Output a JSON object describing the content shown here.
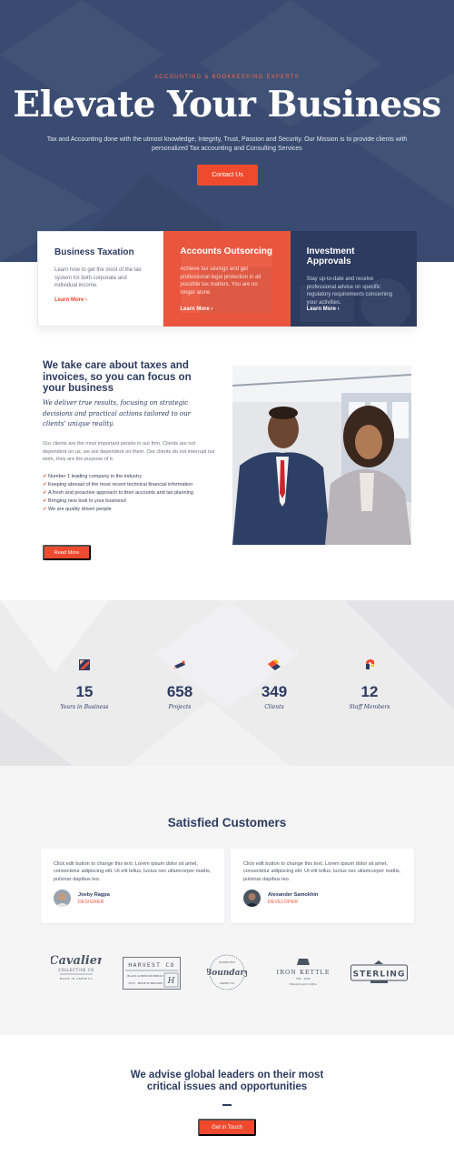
{
  "hero": {
    "eyebrow": "Accounting & Bookkeeping Experts",
    "title": "Elevate Your Business",
    "subtitle": "Tax and Accounting done with the utmost knowledge, Integrity, Trust, Passion and Security. Our Mission is to provide clients with personalized Tax accounting and Consulting Services",
    "cta_label": "Contact Us"
  },
  "services": [
    {
      "title": "Business Taxation",
      "text": "Learn how to get the most of the tax system for both corporate and individual income.",
      "link": "Learn More ›"
    },
    {
      "title": "Accounts Outsorcing",
      "text": "Achieve tax savings and get professional legal protection in all possible tax matters. You are no longer alone",
      "link": "Learn More ›"
    },
    {
      "title": "Investment Approvals",
      "text": "Stay up-to-date and receive professional advice on specific regulatory requirements concerning your activities.",
      "link": "Learn More ›"
    }
  ],
  "about": {
    "heading": "We take care about taxes and invoices, so you can focus on your business",
    "lead": "We deliver true results, focusing on strategic decisions and practical actions tailored to our clients' unique reality.",
    "body": "Our clients are the most important people in our firm. Clients are not dependent on us, we are dependent on them. Our clients do not interrupt our work, they are the purpose of it.",
    "bullets": [
      "Number 1 leading company in the industry",
      "Keeping abreast of the most recent technical financial information",
      "A fresh and proactive approach to their accounts and tax planning",
      "Bringing new look to your business!",
      "We are quality driven people"
    ],
    "button_label": "Read More"
  },
  "stats": [
    {
      "value": "15",
      "label": "Years in Business",
      "icon": "chart-icon"
    },
    {
      "value": "658",
      "label": "Projects",
      "icon": "pen-icon"
    },
    {
      "value": "349",
      "label": "Clients",
      "icon": "handshake-icon"
    },
    {
      "value": "12",
      "label": "Staff Members",
      "icon": "team-icon"
    }
  ],
  "customers": {
    "title": "Satisfied Customers",
    "testimonials": [
      {
        "text": "Click edit button to change this text. Lorem ipsum dolor sit amet, consectetur adipiscing elit. Ut elit tellus, luctus nec ullamcorper mattis, pulvinar dapibus leo.",
        "name": "Joeby Ragpa",
        "role": "DESIGNER"
      },
      {
        "text": "Click edit button to change this text. Lorem ipsum dolor sit amet, consectetur adipiscing elit. Ut elit tellus, luctus nec ullamcorper mattis, pulvinar dapibus leo.",
        "name": "Alexander Samokhin",
        "role": "DEVELOPER"
      }
    ],
    "logos": [
      "Cavalier",
      "Harvest Co",
      "Boundary",
      "Iron Kettle",
      "Sterling"
    ]
  },
  "cta": {
    "heading": "We advise global leaders on their most critical issues and opportunities",
    "button_label": "Get in Touch"
  },
  "colors": {
    "navy": "#2d3b60",
    "hero_bg": "#3a4b72",
    "accent": "#f04a2e"
  }
}
